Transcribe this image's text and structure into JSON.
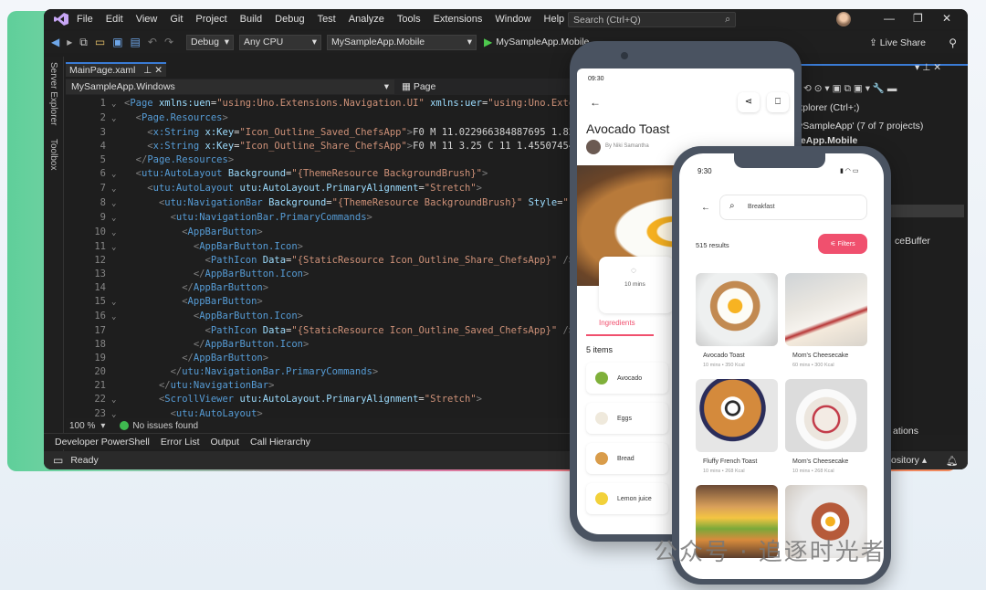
{
  "ide": {
    "menu": [
      "File",
      "Edit",
      "View",
      "Git",
      "Project",
      "Build",
      "Debug",
      "Test",
      "Analyze",
      "Tools",
      "Extensions",
      "Window",
      "Help"
    ],
    "search_placeholder": "Search (Ctrl+Q)",
    "toolbar": {
      "config": "Debug",
      "platform": "Any CPU",
      "project": "MySampleApp.Mobile",
      "run_label": "MySampleApp.Mobile"
    },
    "live_share": "Live Share",
    "side_tabs": [
      "Server Explorer",
      "Toolbox"
    ],
    "doc_tab": "MainPage.xaml",
    "path_left": "MySampleApp.Windows",
    "path_right": "Page",
    "code_lines": [
      {
        "n": "1",
        "f": "⌄",
        "html": "<span class='p'>&lt;</span><span class='t'>Page</span> <span class='a'>xmlns:uen</span><span class='w'>=</span><span class='s'>\"using:Uno.Extensions.Navigation.UI\"</span> <span class='a'>xmlns:uer</span><span class='w'>=</span><span class='s'>\"using:Uno.Extens</span>"
      },
      {
        "n": "2",
        "f": "⌄",
        "html": "  <span class='p'>&lt;</span><span class='t'>Page.Resources</span><span class='p'>&gt;</span>"
      },
      {
        "n": "3",
        "f": "",
        "html": "    <span class='p'>&lt;</span><span class='t'>x:String</span> <span class='a'>x:Key</span><span class='w'>=</span><span class='s'>\"Icon_Outline_Saved_ChefsApp\"</span><span class='p'>&gt;</span><span class='w'>F0 M 11.022966384887695 1.82604</span>"
      },
      {
        "n": "4",
        "f": "",
        "html": "    <span class='p'>&lt;</span><span class='t'>x:String</span> <span class='a'>x:Key</span><span class='w'>=</span><span class='s'>\"Icon_Outline_Share_ChefsApp\"</span><span class='p'>&gt;</span><span class='w'>F0 M 11 3.25 C 11 1.45507454872</span>"
      },
      {
        "n": "5",
        "f": "",
        "html": "  <span class='p'>&lt;/</span><span class='t'>Page.Resources</span><span class='p'>&gt;</span>"
      },
      {
        "n": "6",
        "f": "⌄",
        "html": "  <span class='p'>&lt;</span><span class='t'>utu:AutoLayout</span> <span class='a'>Background</span><span class='w'>=</span><span class='s'>\"{ThemeResource BackgroundBrush}\"</span><span class='p'>&gt;</span>"
      },
      {
        "n": "7",
        "f": "⌄",
        "html": "    <span class='p'>&lt;</span><span class='t'>utu:AutoLayout</span> <span class='a'>utu:AutoLayout.PrimaryAlignment</span><span class='w'>=</span><span class='s'>\"Stretch\"</span><span class='p'>&gt;</span>"
      },
      {
        "n": "8",
        "f": "⌄",
        "html": "      <span class='p'>&lt;</span><span class='t'>utu:NavigationBar</span> <span class='a'>Background</span><span class='w'>=</span><span class='s'>\"{ThemeResource BackgroundBrush}\"</span> <span class='a'>Style</span><span class='w'>=</span><span class='s'>\"{Sta</span>"
      },
      {
        "n": "9",
        "f": "⌄",
        "html": "        <span class='p'>&lt;</span><span class='t'>utu:NavigationBar.PrimaryCommands</span><span class='p'>&gt;</span>"
      },
      {
        "n": "10",
        "f": "⌄",
        "html": "          <span class='p'>&lt;</span><span class='t'>AppBarButton</span><span class='p'>&gt;</span>"
      },
      {
        "n": "11",
        "f": "⌄",
        "html": "            <span class='p'>&lt;</span><span class='t'>AppBarButton.Icon</span><span class='p'>&gt;</span>"
      },
      {
        "n": "12",
        "f": "",
        "html": "              <span class='p'>&lt;</span><span class='t'>PathIcon</span> <span class='a'>Data</span><span class='w'>=</span><span class='s'>\"{StaticResource Icon_Outline_Share_ChefsApp}\"</span> <span class='p'>/&gt;</span>"
      },
      {
        "n": "13",
        "f": "",
        "html": "            <span class='p'>&lt;/</span><span class='t'>AppBarButton.Icon</span><span class='p'>&gt;</span>"
      },
      {
        "n": "14",
        "f": "",
        "html": "          <span class='p'>&lt;/</span><span class='t'>AppBarButton</span><span class='p'>&gt;</span>"
      },
      {
        "n": "15",
        "f": "⌄",
        "html": "          <span class='p'>&lt;</span><span class='t'>AppBarButton</span><span class='p'>&gt;</span>"
      },
      {
        "n": "16",
        "f": "⌄",
        "html": "            <span class='p'>&lt;</span><span class='t'>AppBarButton.Icon</span><span class='p'>&gt;</span>"
      },
      {
        "n": "17",
        "f": "",
        "html": "              <span class='p'>&lt;</span><span class='t'>PathIcon</span> <span class='a'>Data</span><span class='w'>=</span><span class='s'>\"{StaticResource Icon_Outline_Saved_ChefsApp}\"</span> <span class='p'>/&gt;</span>"
      },
      {
        "n": "18",
        "f": "",
        "html": "            <span class='p'>&lt;/</span><span class='t'>AppBarButton.Icon</span><span class='p'>&gt;</span>"
      },
      {
        "n": "19",
        "f": "",
        "html": "          <span class='p'>&lt;/</span><span class='t'>AppBarButton</span><span class='p'>&gt;</span>"
      },
      {
        "n": "20",
        "f": "",
        "html": "        <span class='p'>&lt;/</span><span class='t'>utu:NavigationBar.PrimaryCommands</span><span class='p'>&gt;</span>"
      },
      {
        "n": "21",
        "f": "",
        "html": "      <span class='p'>&lt;/</span><span class='t'>utu:NavigationBar</span><span class='p'>&gt;</span>"
      },
      {
        "n": "22",
        "f": "⌄",
        "html": "      <span class='p'>&lt;</span><span class='t'>ScrollViewer</span> <span class='a'>utu:AutoLayout.PrimaryAlignment</span><span class='w'>=</span><span class='s'>\"Stretch\"</span><span class='p'>&gt;</span>"
      },
      {
        "n": "23",
        "f": "⌄",
        "html": "        <span class='p'>&lt;</span><span class='t'>utu:AutoLayout</span><span class='p'>&gt;</span>"
      }
    ],
    "zoom": "100 %",
    "issues": "No issues found",
    "bottom_tabs": [
      "Developer PowerShell",
      "Error List",
      "Output",
      "Call Hierarchy"
    ],
    "status": "Ready",
    "right_pane": {
      "header": "xplorer (Ctrl+;)",
      "line1": "ySampleApp' (7 of 7 projects)",
      "line2": "leApp.Mobile",
      "line3": "ceBuffer",
      "line4": "ations",
      "repo": "ository"
    }
  },
  "phone_back": {
    "time": "09:30",
    "title": "Avocado Toast",
    "author": "By Niki Samantha",
    "duration": "10 mins",
    "tab": "Ingredients",
    "count": "5 items",
    "ingredients": [
      "Avocado",
      "Eggs",
      "Bread",
      "Lemon juice"
    ]
  },
  "phone_front": {
    "time": "9:30",
    "search_value": "Breakfast",
    "results": "515 results",
    "filters": "Filters",
    "cards": [
      {
        "name": "Avocado Toast",
        "meta": "10 mins • 350 Kcal"
      },
      {
        "name": "Mom's Cheesecake",
        "meta": "60 mins • 300 Kcal"
      },
      {
        "name": "Fluffy French Toast",
        "meta": "10 mins • 268 Kcal"
      },
      {
        "name": "Mom's Cheesecake",
        "meta": "10 mins • 268 Kcal"
      }
    ]
  },
  "watermark": "公众号 · 追逐时光者",
  "colors": {
    "accent": "#f0506e",
    "vs_purple": "#8661c5",
    "ide_bg": "#1e1e1e"
  }
}
